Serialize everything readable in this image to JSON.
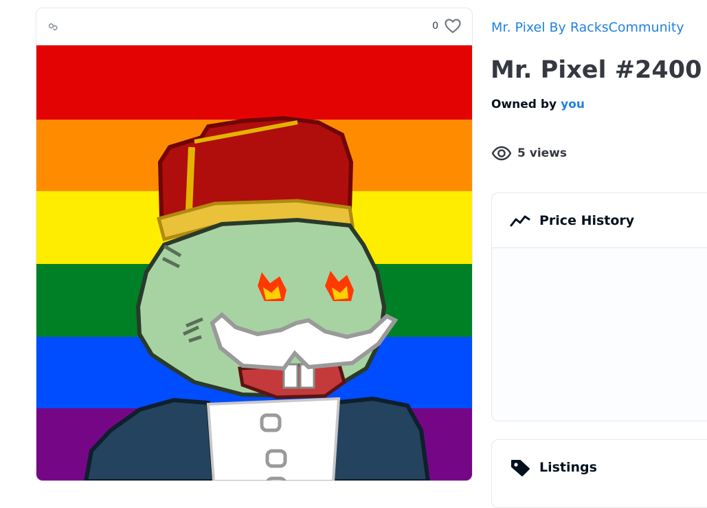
{
  "item": {
    "collection_name": "Mr. Pixel By RacksCommunity",
    "title": "Mr. Pixel #2400",
    "owned_by_label": "Owned by",
    "owner": "you",
    "views_text": "5 views",
    "favorites_count": "0"
  },
  "panels": {
    "price_history": "Price History",
    "listings": "Listings"
  },
  "icons": {
    "chain": "polygon-chain-icon",
    "favorite": "heart-icon",
    "views": "eye-icon",
    "price_history": "trend-line-icon",
    "listings": "tag-icon"
  },
  "colors": {
    "link": "#2081e2",
    "text_dark": "#04111d",
    "text_gray": "#353840",
    "border": "#e5e8eb"
  }
}
